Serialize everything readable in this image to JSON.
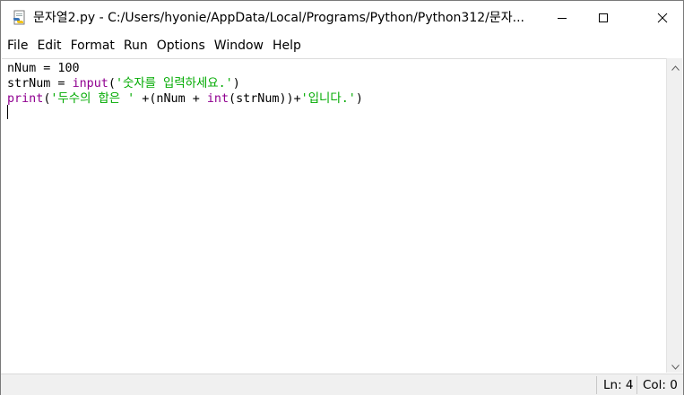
{
  "window": {
    "title": "문자열2.py - C:/Users/hyonie/AppData/Local/Programs/Python/Python312/문자..."
  },
  "title_controls": {
    "minimize_icon": "minimize-icon",
    "maximize_icon": "maximize-icon",
    "close_icon": "close-icon"
  },
  "menu": {
    "items": [
      "File",
      "Edit",
      "Format",
      "Run",
      "Options",
      "Window",
      "Help"
    ]
  },
  "editor": {
    "line1": {
      "t1": "nNum = 100"
    },
    "line2": {
      "t1": "strNum = ",
      "t2": "input",
      "t3": "(",
      "t4": "'숫자를 입력하세요.'",
      "t5": ")"
    },
    "line3": {
      "t1": "print",
      "t2": "(",
      "t3": "'두수의 합은 '",
      "t4": " +(nNum + ",
      "t5": "int",
      "t6": "(strNum))+",
      "t7": "'입니다.'",
      "t8": ")"
    }
  },
  "status": {
    "line": "Ln: 4",
    "col": "Col: 0"
  },
  "colors": {
    "keyword": "#900090",
    "string": "#00aa00",
    "text": "#000000"
  }
}
